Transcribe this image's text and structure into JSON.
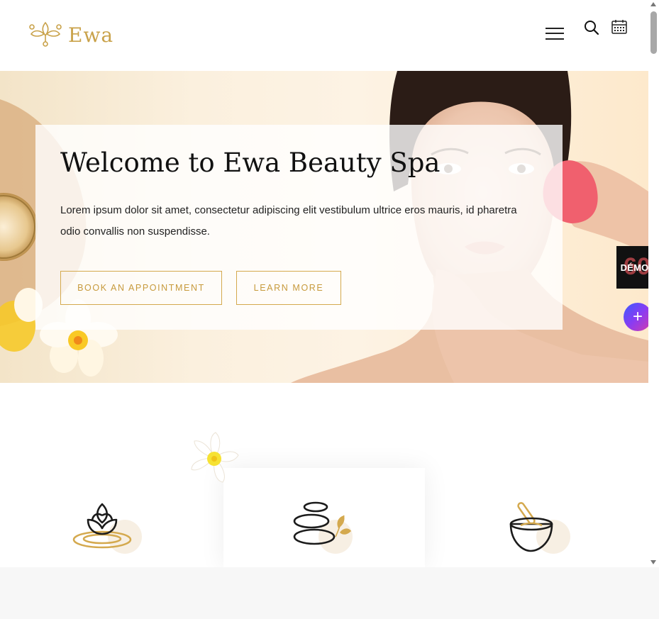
{
  "header": {
    "logo_text": "Ewa",
    "icons": {
      "menu": "hamburger-menu-icon",
      "search": "search-icon",
      "calendar": "calendar-icon"
    }
  },
  "hero": {
    "title": "Welcome to Ewa Beauty Spa",
    "text": "Lorem ipsum dolor sit amet, consectetur adipiscing elit vestibulum ultrice eros mauris, id pharetra odio convallis non suspendisse.",
    "book_label": "BOOK AN APPOINTMENT",
    "learn_label": "LEARN MORE"
  },
  "features": {
    "items": [
      {
        "icon": "lotus-icon"
      },
      {
        "icon": "stones-icon"
      },
      {
        "icon": "mortar-bowl-icon"
      }
    ]
  },
  "widgets": {
    "demos_label": "DÉMOS",
    "demos_bg": "60",
    "plus_label": "+"
  },
  "colors": {
    "accent": "#c9a24a",
    "text": "#111111",
    "demos_bg": "#111111"
  }
}
